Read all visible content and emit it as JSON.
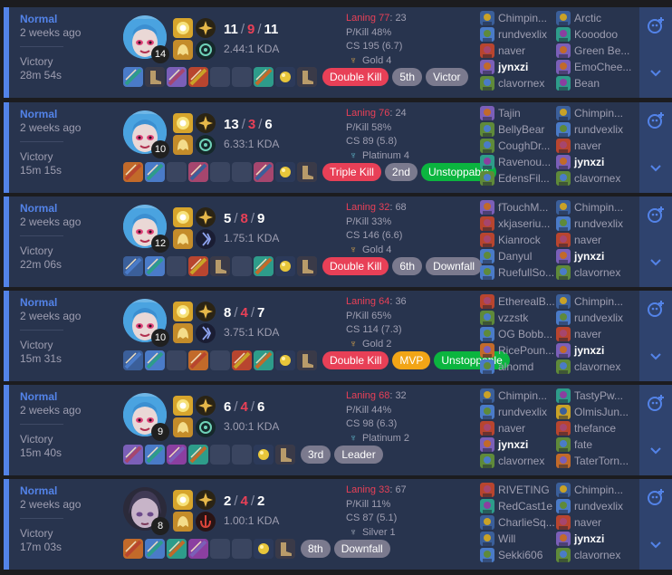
{
  "accent": "#5383e8",
  "kill_color": "#e84057",
  "matches": [
    {
      "queue": "Normal",
      "ago": "2 weeks ago",
      "result": "Victory",
      "duration": "28m 54s",
      "level": "14",
      "kills": "11",
      "deaths": "9",
      "assists": "11",
      "kda_ratio": "2.44:1 KDA",
      "laning_label": "Laning 77",
      "laning_opp": ": 23",
      "pkill": "P/Kill 48%",
      "cs": "CS 195 (6.7)",
      "rank": "Gold 4",
      "rank_icon": "gold-emblem-icon",
      "spells": [
        "flash-spell-icon",
        "ghost-spell-icon"
      ],
      "runes": [
        "press-the-attack-icon",
        "resolve-rune-icon"
      ],
      "items": [
        "kraken-slayer-icon",
        "berserker-greaves-icon",
        "rapid-firecannon-icon",
        "long-sword-icon",
        "",
        "",
        "infinity-edge-icon",
        "stealth-ward-icon",
        "ionian-boots-icon"
      ],
      "badges": [
        {
          "label": "Double Kill",
          "type": "red"
        },
        {
          "label": "5th",
          "type": "gray"
        },
        {
          "label": "Victor",
          "type": "gray"
        }
      ],
      "team1": [
        "Chimpin...",
        "rundvexlix",
        "naver",
        "jynxzi",
        "clavornex"
      ],
      "team2": [
        "Arctic",
        "Kooodoo",
        "Green Be...",
        "EmoChee...",
        "Bean"
      ],
      "me_team": 1,
      "me_index": 3
    },
    {
      "queue": "Normal",
      "ago": "2 weeks ago",
      "result": "Victory",
      "duration": "15m 15s",
      "level": "10",
      "kills": "13",
      "deaths": "3",
      "assists": "6",
      "kda_ratio": "6.33:1 KDA",
      "laning_label": "Laning 76",
      "laning_opp": ": 24",
      "pkill": "P/Kill 58%",
      "cs": "CS 89 (5.8)",
      "rank": "Platinum 4",
      "rank_icon": "platinum-emblem-icon",
      "spells": [
        "flash-spell-icon",
        "ghost-spell-icon"
      ],
      "runes": [
        "press-the-attack-icon",
        "resolve-rune-icon"
      ],
      "items": [
        "sword-icon",
        "kraken-slayer-icon",
        "",
        "crossed-blades-icon",
        "",
        "",
        "recurve-bow-icon",
        "gold-ward-icon",
        "ionian-boots-icon"
      ],
      "badges": [
        {
          "label": "Triple Kill",
          "type": "red"
        },
        {
          "label": "2nd",
          "type": "gray"
        },
        {
          "label": "Unstoppable",
          "type": "green"
        }
      ],
      "team1": [
        "Tajin",
        "BellyBear",
        "CoughDr...",
        "Ravenou...",
        "EdensFil..."
      ],
      "team2": [
        "Chimpin...",
        "rundvexlix",
        "naver",
        "jynxzi",
        "clavornex"
      ],
      "me_team": 2,
      "me_index": 3
    },
    {
      "queue": "Normal",
      "ago": "2 weeks ago",
      "result": "Victory",
      "duration": "22m 06s",
      "level": "12",
      "kills": "5",
      "deaths": "8",
      "assists": "9",
      "kda_ratio": "1.75:1 KDA",
      "laning_label": "Laning 32",
      "laning_opp": ": 68",
      "pkill": "P/Kill 33%",
      "cs": "CS 146 (6.6)",
      "rank": "Gold 4",
      "rank_icon": "gold-emblem-icon",
      "spells": [
        "flash-spell-icon",
        "ghost-spell-icon"
      ],
      "runes": [
        "lethal-tempo-icon",
        "sorcery-rune-icon"
      ],
      "items": [
        "galeforce-icon",
        "kraken-slayer-icon",
        "",
        "hammer-icon",
        "boots-icon",
        "",
        "infinity-edge-icon",
        "gold-ward-icon",
        "ionian-boots-icon"
      ],
      "badges": [
        {
          "label": "Double Kill",
          "type": "red"
        },
        {
          "label": "6th",
          "type": "gray"
        },
        {
          "label": "Downfall",
          "type": "gray"
        }
      ],
      "team1": [
        "fTouchM...",
        "xkjaseriu...",
        "Kianrock",
        "Danyul",
        "RuefullSo..."
      ],
      "team2": [
        "Chimpin...",
        "rundvexlix",
        "naver",
        "jynxzi",
        "clavornex"
      ],
      "me_team": 2,
      "me_index": 3
    },
    {
      "queue": "Normal",
      "ago": "2 weeks ago",
      "result": "Victory",
      "duration": "15m 31s",
      "level": "10",
      "kills": "8",
      "deaths": "4",
      "assists": "7",
      "kda_ratio": "3.75:1 KDA",
      "laning_label": "Laning 64",
      "laning_opp": ": 36",
      "pkill": "P/Kill 65%",
      "cs": "CS 114 (7.3)",
      "rank": "Gold 2",
      "rank_icon": "gold-emblem-icon",
      "spells": [
        "flash-spell-icon",
        "ghost-spell-icon"
      ],
      "runes": [
        "fleet-footwork-icon",
        "sorcery-rune-icon"
      ],
      "items": [
        "galeforce-icon",
        "kraken-slayer-icon",
        "",
        "sword-icon",
        "",
        "long-sword-icon",
        "infinity-edge-icon",
        "gold-ward-icon",
        "ionian-boots-icon"
      ],
      "badges": [
        {
          "label": "Double Kill",
          "type": "red"
        },
        {
          "label": "MVP",
          "type": "gold"
        },
        {
          "label": "Unstoppable",
          "type": "green"
        }
      ],
      "team1": [
        "EtherealB...",
        "vzzstk",
        "OG Bobb...",
        "RicePoun...",
        "alnomd"
      ],
      "team2": [
        "Chimpin...",
        "rundvexlix",
        "naver",
        "jynxzi",
        "clavornex"
      ],
      "me_team": 2,
      "me_index": 3
    },
    {
      "queue": "Normal",
      "ago": "2 weeks ago",
      "result": "Victory",
      "duration": "15m 40s",
      "level": "9",
      "kills": "6",
      "deaths": "4",
      "assists": "6",
      "kda_ratio": "3.00:1 KDA",
      "laning_label": "Laning 68",
      "laning_opp": ": 32",
      "pkill": "P/Kill 44%",
      "cs": "CS 98 (6.3)",
      "rank": "Platinum 2",
      "rank_icon": "platinum-emblem-icon",
      "spells": [
        "flash-spell-icon",
        "ghost-spell-icon"
      ],
      "runes": [
        "press-the-attack-icon",
        "resolve-rune-icon"
      ],
      "items": [
        "rapid-firecannon-icon",
        "kraken-slayer-icon",
        "phantom-dancer-icon",
        "scythe-icon",
        "",
        "",
        "gold-ward-icon",
        "ionian-boots-icon"
      ],
      "badges": [
        {
          "label": "3rd",
          "type": "gray"
        },
        {
          "label": "Leader",
          "type": "gray"
        }
      ],
      "team1": [
        "Chimpin...",
        "rundvexlix",
        "naver",
        "jynxzi",
        "clavornex"
      ],
      "team2": [
        "TastyPw...",
        "OlmisJun...",
        "thefance",
        "fate",
        "TaterTorn..."
      ],
      "me_team": 1,
      "me_index": 3
    },
    {
      "queue": "Normal",
      "ago": "2 weeks ago",
      "result": "Victory",
      "duration": "17m 03s",
      "level": "8",
      "kills": "2",
      "deaths": "4",
      "assists": "2",
      "kda_ratio": "1.00:1 KDA",
      "laning_label": "Laning 33",
      "laning_opp": ": 67",
      "pkill": "P/Kill 11%",
      "cs": "CS 87 (5.1)",
      "rank": "Silver 1",
      "rank_icon": "silver-emblem-icon",
      "spells": [
        "flash-spell-icon",
        "ghost-spell-icon"
      ],
      "runes": [
        "press-the-attack-icon",
        "domination-rune-icon"
      ],
      "items": [
        "sword-icon",
        "kraken-slayer-icon",
        "blade-icon",
        "lance-icon",
        "",
        "",
        "gold-ward-icon",
        "ionian-boots-icon"
      ],
      "badges": [
        {
          "label": "8th",
          "type": "gray"
        },
        {
          "label": "Downfall",
          "type": "gray"
        }
      ],
      "team1": [
        "RIVETING",
        "RedCast1e",
        "CharlieSq...",
        "Will",
        "Sekki606"
      ],
      "team2": [
        "Chimpin...",
        "rundvexlix",
        "naver",
        "jynxzi",
        "clavornex"
      ],
      "me_team": 2,
      "me_index": 3
    }
  ]
}
